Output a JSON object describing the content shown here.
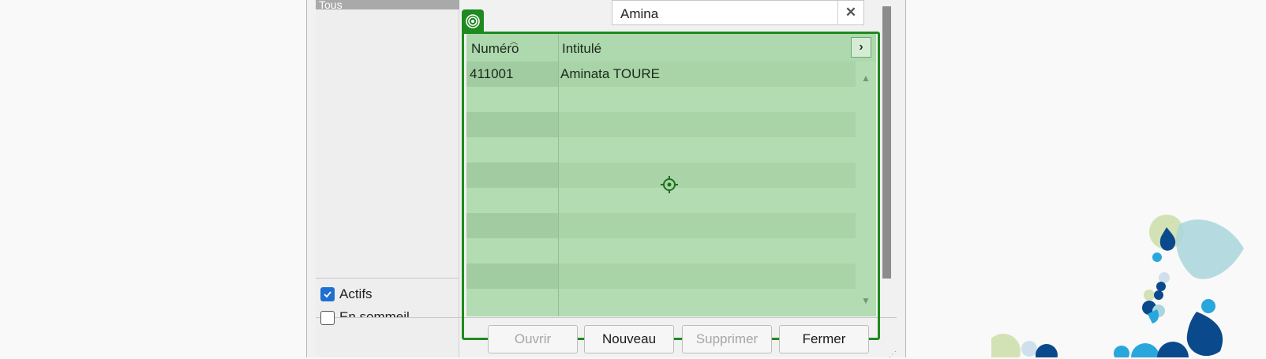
{
  "left_panel": {
    "selected_item": "Tous",
    "checkboxes": [
      {
        "label": "Actifs",
        "checked": true
      },
      {
        "label": "En sommeil",
        "checked": false
      }
    ]
  },
  "search": {
    "value": "Amina",
    "clear_icon": "close-icon"
  },
  "grid": {
    "columns": [
      "Numéro",
      "Intitulé"
    ],
    "rows": [
      {
        "numero": "411001",
        "intitule": "Aminata TOURE"
      }
    ],
    "empty_row_count": 9,
    "expand_icon": "chevron-right-icon",
    "highlight_color": "#1f8a1f"
  },
  "buttons": {
    "open": "Ouvrir",
    "new": "Nouveau",
    "delete": "Supprimer",
    "close": "Fermer"
  }
}
